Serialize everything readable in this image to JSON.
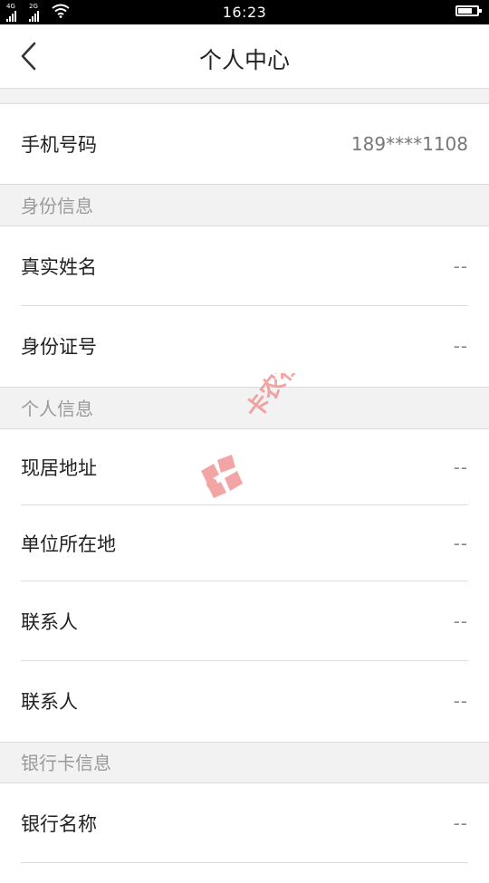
{
  "status_bar": {
    "time": "16:23",
    "network1": "4G",
    "network2": "2G"
  },
  "header": {
    "title": "个人中心",
    "back_icon": "chevron-left-icon"
  },
  "phone": {
    "label": "手机号码",
    "value": "189****1108"
  },
  "identity": {
    "header": "身份信息",
    "items": [
      {
        "label": "真实姓名",
        "value": "--"
      },
      {
        "label": "身份证号",
        "value": "--"
      }
    ]
  },
  "personal": {
    "header": "个人信息",
    "items": [
      {
        "label": "现居地址",
        "value": "--"
      },
      {
        "label": "单位所在地",
        "value": "--"
      },
      {
        "label": "联系人",
        "value": "--"
      },
      {
        "label": "联系人",
        "value": "--"
      }
    ]
  },
  "bank": {
    "header": "银行卡信息",
    "items": [
      {
        "label": "银行名称",
        "value": "--"
      }
    ]
  },
  "watermark": {
    "text": "卡农社区",
    "color": "#f08a8a"
  }
}
